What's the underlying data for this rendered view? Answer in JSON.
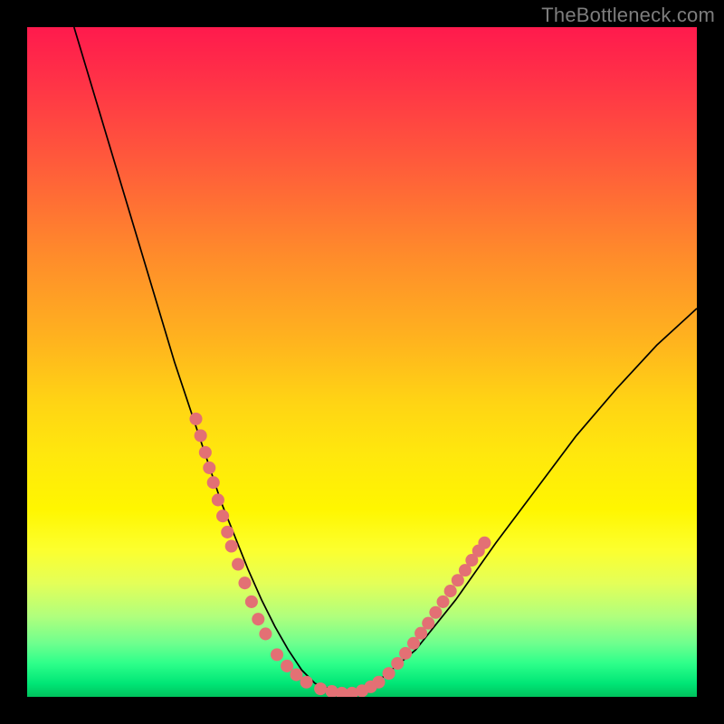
{
  "watermark": "TheBottleneck.com",
  "chart_data": {
    "type": "line",
    "title": "",
    "xlabel": "",
    "ylabel": "",
    "xlim": [
      0,
      100
    ],
    "ylim": [
      0,
      100
    ],
    "grid": false,
    "series": [
      {
        "name": "curve",
        "stroke": "#000000",
        "x": [
          7,
          10,
          13,
          16,
          19,
          22,
          25,
          27,
          29,
          31,
          33,
          35,
          37,
          39,
          41,
          43,
          47,
          52,
          58,
          64,
          70,
          76,
          82,
          88,
          94,
          100
        ],
        "y": [
          100,
          90,
          80,
          70,
          60,
          50,
          41,
          35,
          29,
          24,
          19,
          14.5,
          10.5,
          7,
          4,
          2,
          0.5,
          2,
          7,
          14.5,
          23,
          31,
          39,
          46,
          52.5,
          58
        ]
      }
    ],
    "markers": [
      {
        "name": "left-cluster",
        "color": "#e37074",
        "points": [
          [
            25.2,
            41.5
          ],
          [
            25.9,
            39.0
          ],
          [
            26.6,
            36.5
          ],
          [
            27.2,
            34.2
          ],
          [
            27.8,
            32.0
          ],
          [
            28.5,
            29.4
          ],
          [
            29.2,
            27.0
          ],
          [
            29.9,
            24.6
          ],
          [
            30.5,
            22.5
          ],
          [
            31.5,
            19.8
          ],
          [
            32.5,
            17.0
          ],
          [
            33.5,
            14.2
          ],
          [
            34.5,
            11.6
          ],
          [
            35.6,
            9.4
          ],
          [
            37.3,
            6.3
          ],
          [
            38.8,
            4.6
          ],
          [
            40.2,
            3.3
          ],
          [
            41.7,
            2.2
          ]
        ]
      },
      {
        "name": "bottom-cluster",
        "color": "#e37074",
        "points": [
          [
            43.8,
            1.2
          ],
          [
            45.5,
            0.8
          ],
          [
            47.0,
            0.55
          ],
          [
            48.5,
            0.55
          ],
          [
            50.0,
            0.9
          ],
          [
            51.3,
            1.5
          ],
          [
            52.5,
            2.2
          ]
        ]
      },
      {
        "name": "right-cluster",
        "color": "#e37074",
        "points": [
          [
            54.0,
            3.5
          ],
          [
            55.3,
            5.0
          ],
          [
            56.5,
            6.5
          ],
          [
            57.7,
            8.0
          ],
          [
            58.8,
            9.5
          ],
          [
            59.9,
            11.0
          ],
          [
            61.0,
            12.6
          ],
          [
            62.1,
            14.2
          ],
          [
            63.2,
            15.8
          ],
          [
            64.3,
            17.4
          ],
          [
            65.4,
            18.9
          ],
          [
            66.4,
            20.4
          ],
          [
            67.4,
            21.8
          ],
          [
            68.3,
            23.0
          ]
        ]
      }
    ]
  },
  "colors": {
    "marker": "#e37074",
    "curve": "#000000",
    "frame": "#000000",
    "watermark": "#7d7d7d"
  }
}
